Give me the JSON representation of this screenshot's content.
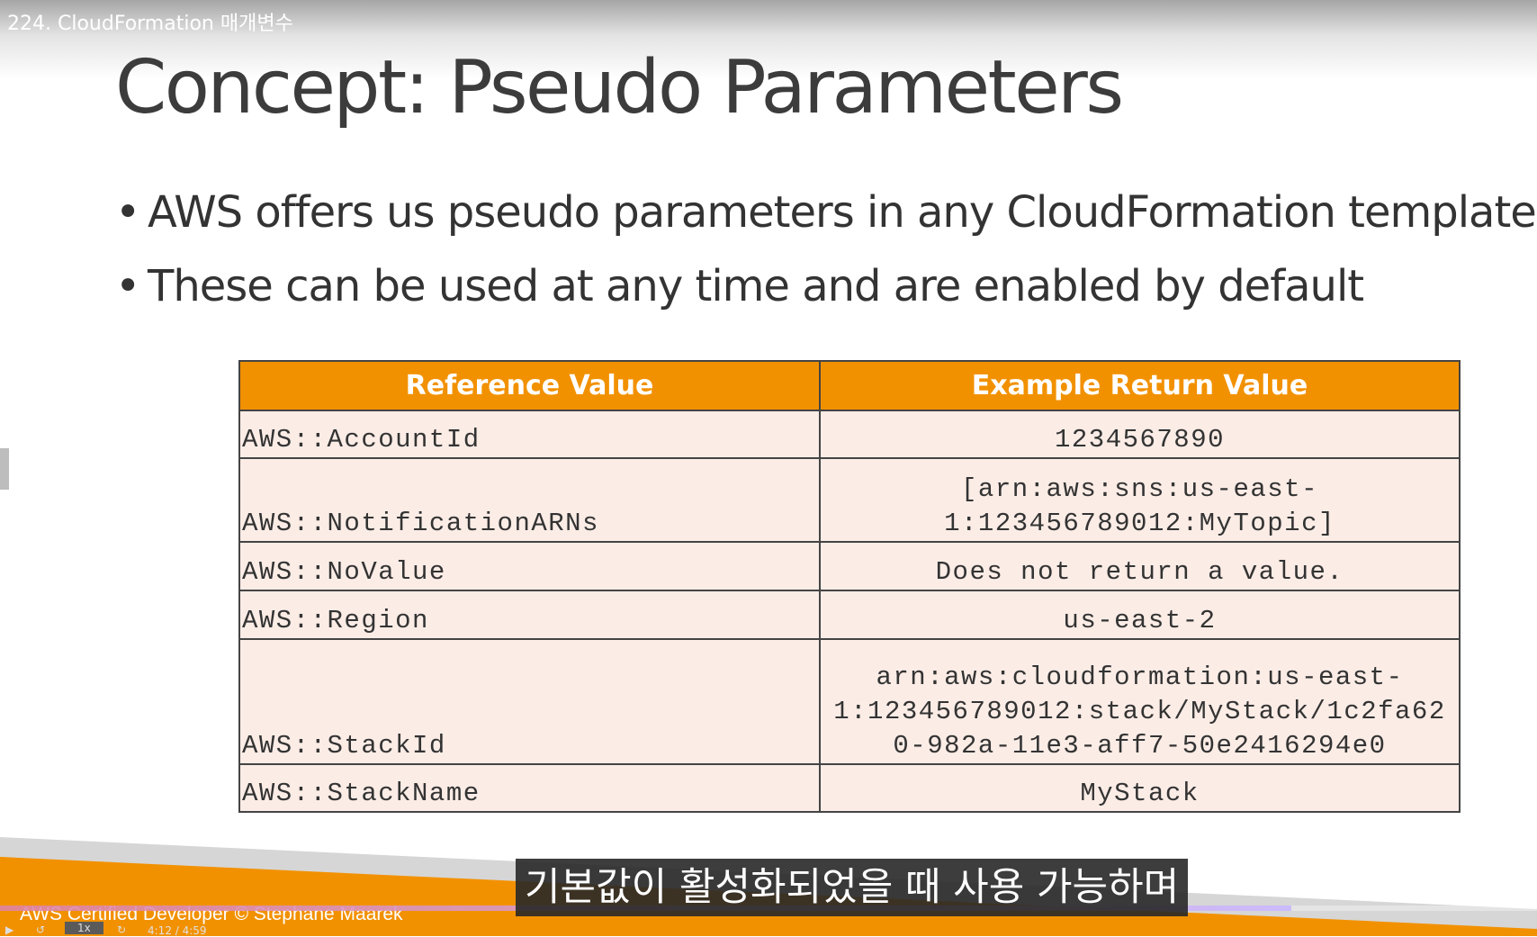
{
  "video_title": "224. CloudFormation 매개변수",
  "slide": {
    "title": "Concept: Pseudo Parameters",
    "bullets": [
      "AWS offers us pseudo parameters in any CloudFormation template.",
      "These can be used at any time and are enabled by default"
    ],
    "bullet_symbol": "•",
    "table": {
      "headers": [
        "Reference Value",
        "Example Return Value"
      ],
      "rows": [
        {
          "ref": "AWS::AccountId",
          "ret": [
            "1234567890"
          ]
        },
        {
          "ref": "AWS::NotificationARNs",
          "ret": [
            "[arn:aws:sns:us-east-",
            "1:123456789012:MyTopic]"
          ]
        },
        {
          "ref": "AWS::NoValue",
          "ret": [
            "Does not return a value."
          ]
        },
        {
          "ref": "AWS::Region",
          "ret": [
            "us-east-2"
          ]
        },
        {
          "ref": "AWS::StackId",
          "ret": [
            "arn:aws:cloudformation:us-east-",
            "1:123456789012:stack/MyStack/1c2fa62",
            "0-982a-11e3-aff7-50e2416294e0"
          ]
        },
        {
          "ref": "AWS::StackName",
          "ret": [
            "MyStack"
          ]
        }
      ]
    },
    "footer": "AWS Certified Developer © Stephane Maarek"
  },
  "subtitle": "기본값이 활성화되었을 때 사용 가능하며",
  "player": {
    "time": "4:12 / 4:59",
    "speed": "1x",
    "progress_fraction": 0.84
  },
  "colors": {
    "header_orange": "#f29100",
    "cell_bg": "#fbece6",
    "footer_orange": "#f29100"
  }
}
